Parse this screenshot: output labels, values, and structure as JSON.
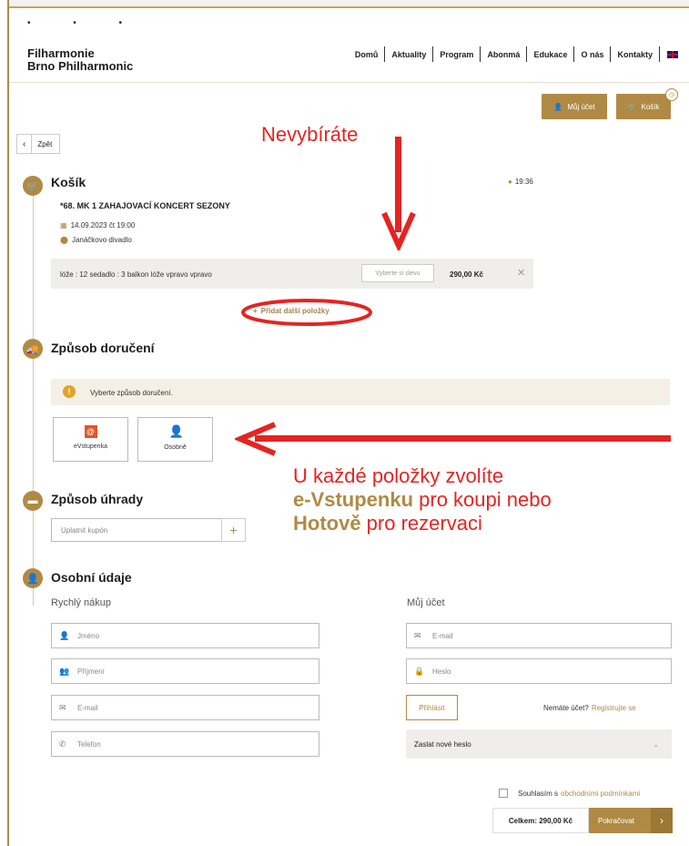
{
  "header": {
    "logo_line1": "Filharmonie",
    "logo_line2": "Brno Philharmonic",
    "nav": [
      "Domů",
      "Aktuality",
      "Program",
      "Abonmá",
      "Edukace",
      "O nás",
      "Kontakty"
    ],
    "account_label": "Můj účet",
    "cart_label": "Košík"
  },
  "back_label": "Zpět",
  "cart": {
    "title": "Košík",
    "timer": "19:36",
    "event_title": "*68. MK 1 ZAHAJOVACÍ KONCERT SEZONY",
    "date": "14.09.2023 čt 19:00",
    "venue": "Janáčkovo divadlo",
    "seat": "lóže : 12 sedadlo : 3 balkon lóže vpravo vpravo",
    "discount_button": "Vyberte si slevu",
    "price": "290,00 Kč",
    "add_more": "Přidat další položky"
  },
  "delivery": {
    "title": "Způsob doručení",
    "notice": "Vyberte způsob doručení.",
    "options": [
      "eVstupenka",
      "Osobně"
    ]
  },
  "payment": {
    "title": "Způsob úhrady",
    "coupon_placeholder": "Uplatnit kupón"
  },
  "personal": {
    "title": "Osobní údaje",
    "quick_heading": "Rychlý nákup",
    "account_heading": "Můj účet",
    "quick_fields": [
      "Jméno",
      "Příjmení",
      "E-mail",
      "Telefon"
    ],
    "account_fields": [
      "E-mail",
      "Heslo"
    ],
    "login_button": "Přihlásit",
    "no_account": "Nemáte účet?",
    "register_link": "Registrujte se",
    "send_password": "Zaslat nové heslo"
  },
  "footer": {
    "agree_text": "Souhlasím s",
    "terms_link": "obchodními podmínkami",
    "total": "Celkem: 290,00 Kč",
    "continue_button": "Pokračovat"
  },
  "annotations": {
    "nevybirate": "Nevybíráte",
    "line1": "U každé položky zvolíte",
    "bold1": "e-Vstupenku",
    "rest2": " pro koupi nebo",
    "bold2": "Hotově",
    "rest3": " pro rezervaci"
  },
  "colors": {
    "gold": "#b08a44",
    "annotation_red": "#e52421"
  }
}
